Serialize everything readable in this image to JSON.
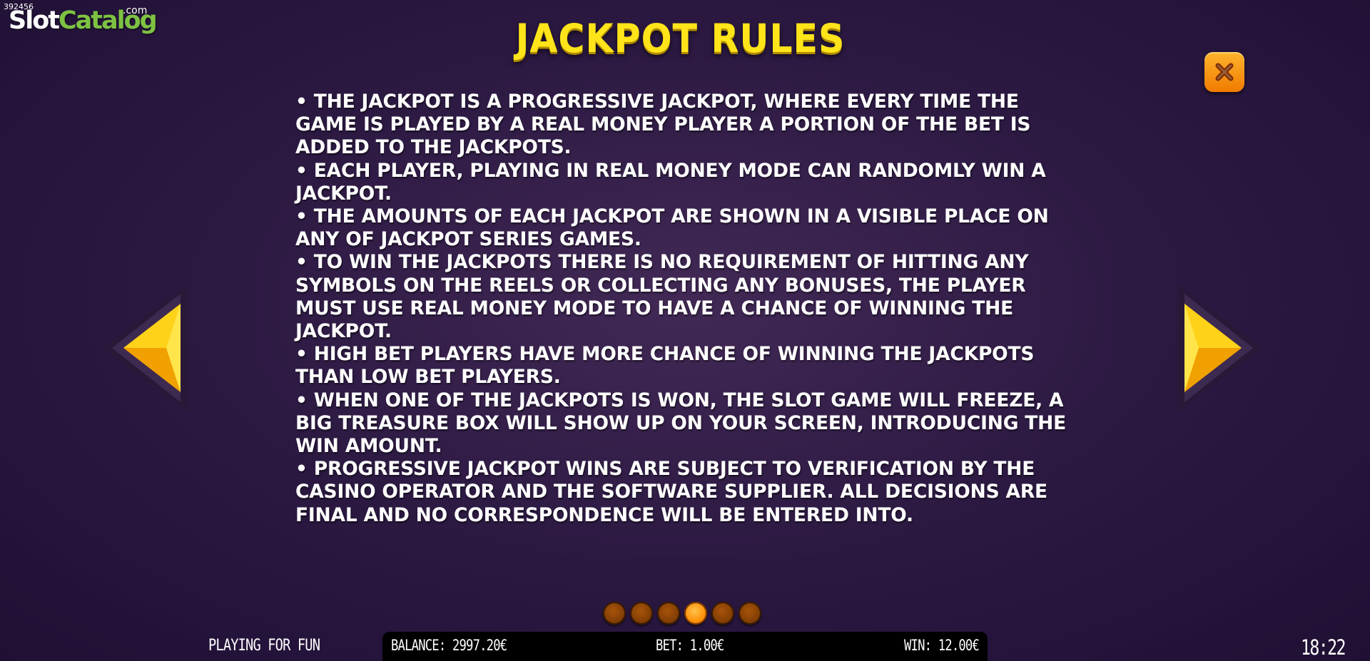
{
  "watermark": {
    "id": "392456",
    "brand_slot": "Slot",
    "brand_catalog": "Catalog",
    "brand_suffix": ".com"
  },
  "title": "JACKPOT RULES",
  "rules": [
    "• THE JACKPOT IS A PROGRESSIVE JACKPOT, WHERE EVERY TIME THE GAME IS PLAYED BY A REAL MONEY PLAYER A PORTION OF THE BET IS ADDED TO THE JACKPOTS.",
    "• EACH PLAYER, PLAYING IN REAL MONEY MODE CAN RANDOMLY WIN A JACKPOT.",
    "• THE AMOUNTS OF EACH JACKPOT ARE SHOWN IN A VISIBLE PLACE ON ANY OF JACKPOT SERIES GAMES.",
    "• TO WIN THE JACKPOTS THERE IS NO REQUIREMENT OF HITTING ANY SYMBOLS ON THE REELS OR COLLECTING ANY BONUSES, THE PLAYER MUST USE REAL MONEY MODE TO HAVE A CHANCE OF WINNING THE JACKPOT.",
    "• HIGH BET PLAYERS HAVE MORE CHANCE OF WINNING THE JACKPOTS THAN LOW BET PLAYERS.",
    "• WHEN ONE OF THE JACKPOTS IS WON, THE SLOT GAME WILL FREEZE, A BIG TREASURE BOX WILL SHOW UP ON YOUR SCREEN, INTRODUCING THE WIN AMOUNT.",
    "• PROGRESSIVE JACKPOT WINS ARE SUBJECT TO VERIFICATION BY THE CASINO OPERATOR AND THE SOFTWARE SUPPLIER. ALL DECISIONS ARE FINAL AND NO CORRESPONDENCE WILL BE ENTERED INTO."
  ],
  "pagination": {
    "total": 6,
    "current": 4
  },
  "status_bar": {
    "mode": "PLAYING FOR FUN",
    "balance": "BALANCE: 2997.20€",
    "bet": "BET: 1.00€",
    "win": "WIN: 12.00€",
    "clock": "18:22"
  },
  "icons": {
    "close": "close-icon",
    "prev": "arrow-left-icon",
    "next": "arrow-right-icon"
  },
  "colors": {
    "title": "#ffe41a",
    "close_button": "#f5900a",
    "arrow": "#ffc400",
    "dot_active": "#ff9a10",
    "dot_inactive": "#8a4206",
    "background": "#2d1a43"
  }
}
